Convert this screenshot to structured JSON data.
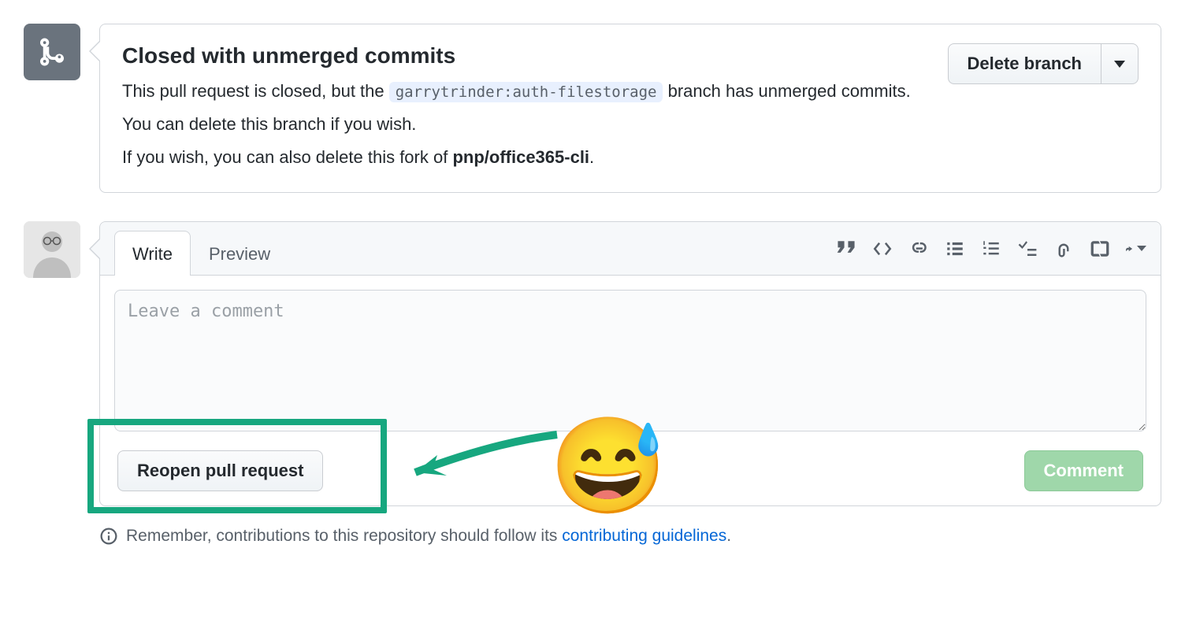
{
  "closed_panel": {
    "title": "Closed with unmerged commits",
    "text_before_branch": "This pull request is closed, but the ",
    "branch": "garrytrinder:auth-filestorage",
    "text_after_branch": " branch has unmerged commits. You can delete this branch if you wish.",
    "text_fork_before": "If you wish, you can also delete this fork of ",
    "fork_repo": "pnp/office365-cli",
    "text_fork_after": ".",
    "delete_button": "Delete branch"
  },
  "comment": {
    "tabs": {
      "write": "Write",
      "preview": "Preview"
    },
    "placeholder": "Leave a comment",
    "reopen_button": "Reopen pull request",
    "comment_button": "Comment"
  },
  "footer": {
    "text_before": "Remember, contributions to this repository should follow its ",
    "link": "contributing guidelines",
    "text_after": "."
  },
  "annotation_emoji": "😅"
}
